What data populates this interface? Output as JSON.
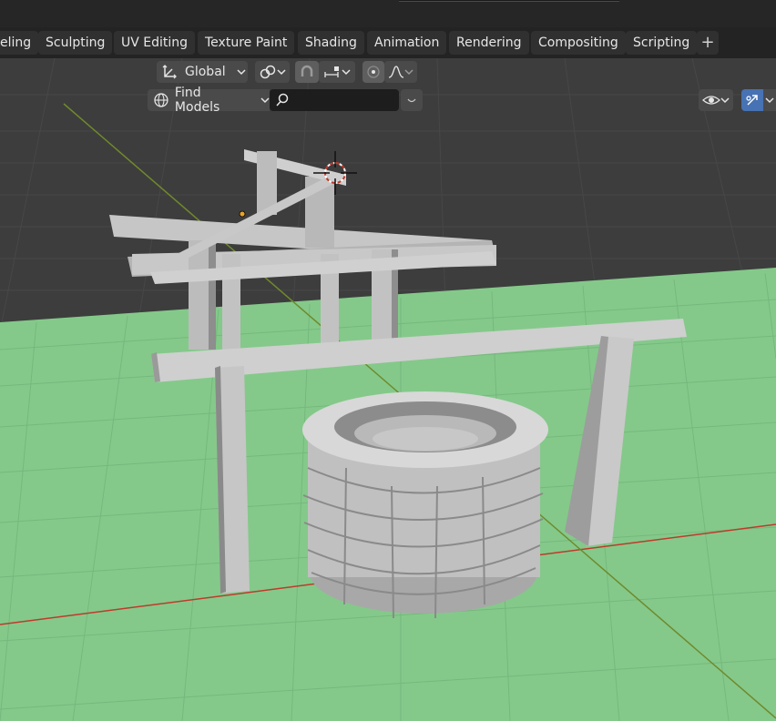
{
  "workspace_tabs": [
    {
      "label": "eling"
    },
    {
      "label": "Sculpting"
    },
    {
      "label": "UV Editing"
    },
    {
      "label": "Texture Paint"
    },
    {
      "label": "Shading"
    },
    {
      "label": "Animation"
    },
    {
      "label": "Rendering"
    },
    {
      "label": "Compositing"
    },
    {
      "label": "Scripting"
    }
  ],
  "add_workspace_label": "+",
  "header": {
    "orientation_label": "Global",
    "search_mode_label": "Find Models",
    "search_placeholder": ""
  },
  "colors": {
    "grid_floor": "#84c98a",
    "sky": "#3d3d3d",
    "x_axis": "#c0392b",
    "y_axis": "#6f8a2c",
    "object_light": "#c8c8c8",
    "object_dark": "#8c8c8c"
  },
  "icons": {
    "transform_orientation": "transform-axis-icon",
    "pivot": "link-rings-icon",
    "snap": "magnet-icon",
    "snap_target": "snap-increment-icon",
    "proportional": "proportional-edit-icon",
    "falloff": "falloff-curve-icon",
    "globe": "globe-icon",
    "search": "search-icon",
    "visibility": "eye-icon",
    "gizmo": "gizmo-icon"
  }
}
